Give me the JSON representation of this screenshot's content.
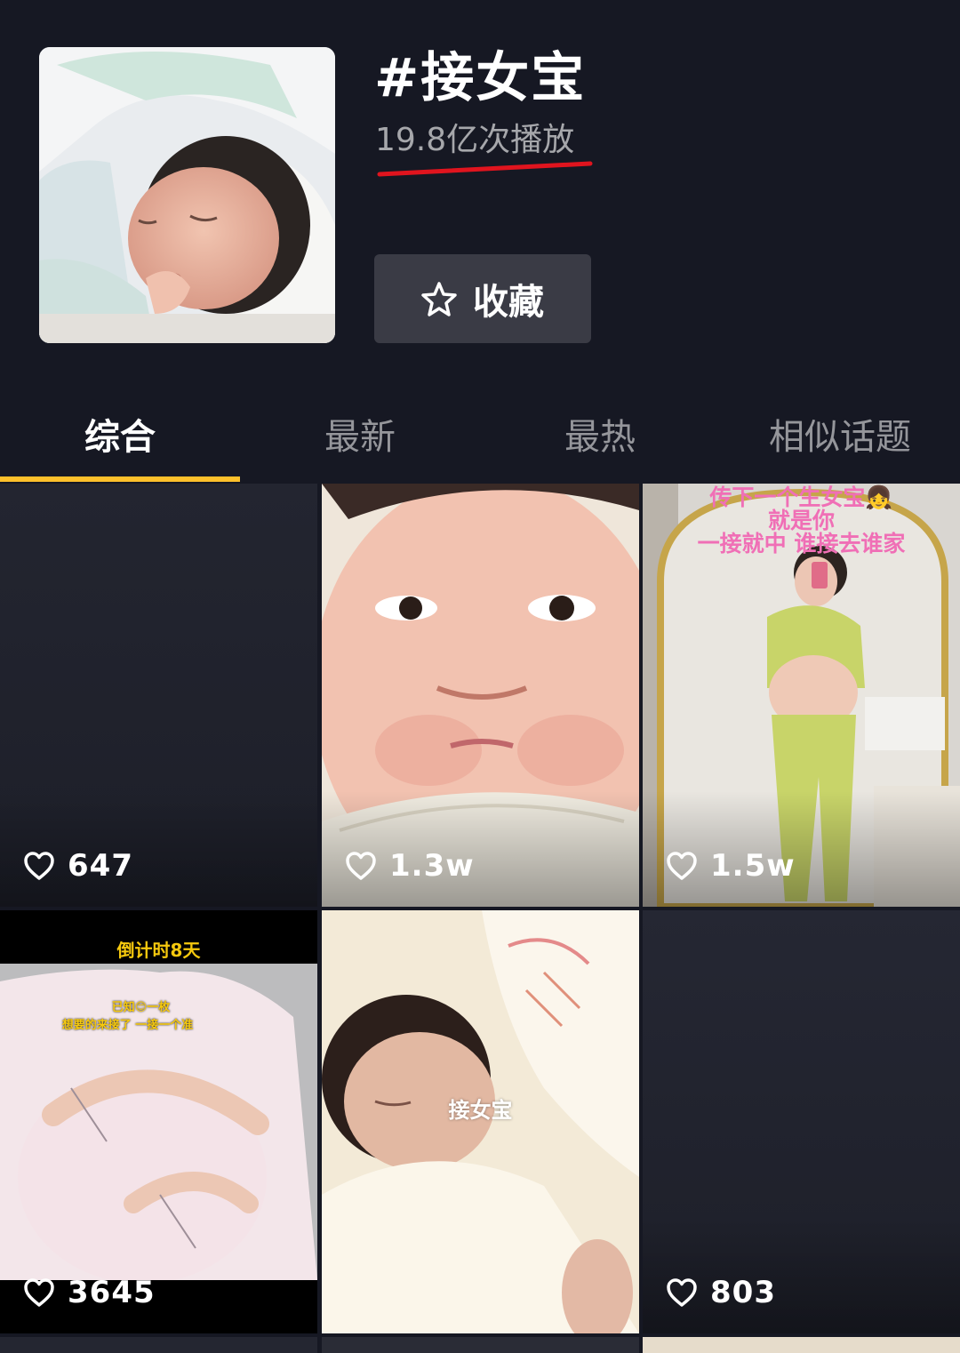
{
  "header": {
    "title": "#接女宝",
    "plays": "19.8亿次播放",
    "favorite_label": "收藏",
    "accent_underline_color": "#e0141e"
  },
  "tabs": [
    {
      "label": "综合",
      "active": true
    },
    {
      "label": "最新",
      "active": false
    },
    {
      "label": "最热",
      "active": false
    },
    {
      "label": "相似话题",
      "active": false
    }
  ],
  "tab_indicator_color": "#fdc02b",
  "videos": [
    {
      "likes": "647",
      "overlay": []
    },
    {
      "likes": "1.3w",
      "overlay": []
    },
    {
      "likes": "1.5w",
      "overlay": [
        "传下一个生女宝👧",
        "就是你",
        "一接就中 谁接去谁家"
      ]
    },
    {
      "likes": "3645",
      "overlay": [
        "倒计时8天",
        "已知😊一枚",
        "想要的来接了 一接一个准"
      ]
    },
    {
      "likes": "",
      "overlay": [
        "接女宝"
      ]
    },
    {
      "likes": "803",
      "overlay": []
    }
  ],
  "icons": {
    "favorite": "star-outline-icon",
    "like": "heart-outline-icon"
  }
}
